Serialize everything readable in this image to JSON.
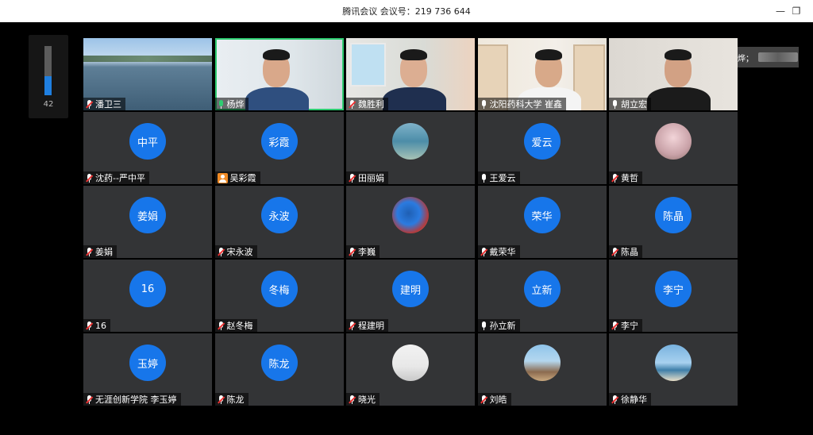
{
  "window": {
    "title": "腾讯会议 会议号：219 736 644",
    "min_icon": "minimize-icon",
    "max_icon": "restore-icon"
  },
  "meter": {
    "value_label": "42",
    "level": 0.38,
    "accent": "#1f7fe0"
  },
  "speaking": {
    "label": "正在讲话：杨烨；"
  },
  "participants": [
    {
      "name": "潘卫三",
      "mic": "muted",
      "type": "video"
    },
    {
      "name": "杨烨",
      "mic": "active",
      "type": "video"
    },
    {
      "name": "魏胜利",
      "mic": "muted",
      "type": "video"
    },
    {
      "name": "沈阳药科大学 崔鑫",
      "mic": "on",
      "type": "video"
    },
    {
      "name": "胡立宏",
      "mic": "on",
      "type": "video"
    },
    {
      "name": "沈药--严中平",
      "mic": "muted",
      "type": "avatar",
      "avatar_text": "中平"
    },
    {
      "name": "吴彩霞",
      "mic": "person",
      "type": "avatar",
      "avatar_text": "彩霞"
    },
    {
      "name": "田丽娟",
      "mic": "muted",
      "type": "photo"
    },
    {
      "name": "王爱云",
      "mic": "on",
      "type": "avatar",
      "avatar_text": "爱云"
    },
    {
      "name": "黄哲",
      "mic": "muted",
      "type": "photo"
    },
    {
      "name": "姜娟",
      "mic": "muted",
      "type": "avatar",
      "avatar_text": "姜娟"
    },
    {
      "name": "宋永波",
      "mic": "muted",
      "type": "avatar",
      "avatar_text": "永波"
    },
    {
      "name": "李巍",
      "mic": "muted",
      "type": "photo"
    },
    {
      "name": "戴荣华",
      "mic": "muted",
      "type": "avatar",
      "avatar_text": "荣华"
    },
    {
      "name": "陈晶",
      "mic": "muted",
      "type": "avatar",
      "avatar_text": "陈晶"
    },
    {
      "name": "16",
      "mic": "muted",
      "type": "avatar",
      "avatar_text": "16"
    },
    {
      "name": "赵冬梅",
      "mic": "muted",
      "type": "avatar",
      "avatar_text": "冬梅"
    },
    {
      "name": "程建明",
      "mic": "muted",
      "type": "avatar",
      "avatar_text": "建明"
    },
    {
      "name": "孙立新",
      "mic": "on",
      "type": "avatar",
      "avatar_text": "立新"
    },
    {
      "name": "李宁",
      "mic": "muted",
      "type": "avatar",
      "avatar_text": "李宁"
    },
    {
      "name": "无涯创新学院 李玉婷",
      "mic": "muted",
      "type": "avatar",
      "avatar_text": "玉婷"
    },
    {
      "name": "陈龙",
      "mic": "muted",
      "type": "avatar",
      "avatar_text": "陈龙"
    },
    {
      "name": "晓光",
      "mic": "muted",
      "type": "photo"
    },
    {
      "name": "刘皓",
      "mic": "muted",
      "type": "photo"
    },
    {
      "name": "徐静华",
      "mic": "muted",
      "type": "photo"
    }
  ],
  "colors": {
    "tile_bg": "#333436",
    "avatar_blue": "#1776ea",
    "active_border": "#2ecc71",
    "muted_red": "#e33333"
  }
}
